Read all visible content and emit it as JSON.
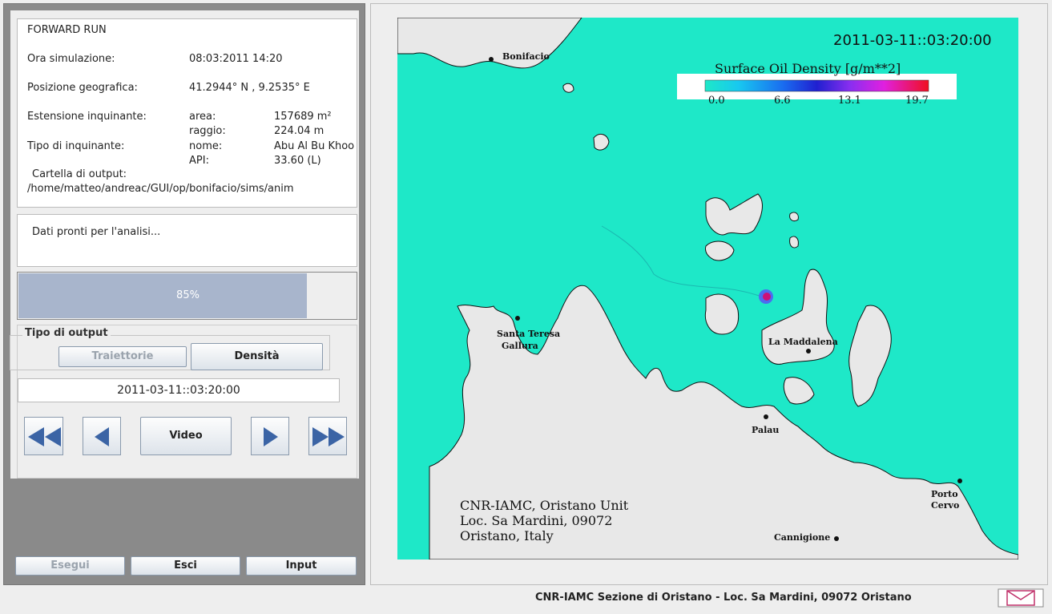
{
  "info": {
    "run_title": "FORWARD RUN",
    "sim_time_label": "Ora simulazione:",
    "sim_time_value": "08:03:2011  14:20",
    "geo_label": "Posizione geografica:",
    "geo_value": "41.2944° N , 9.2535° E",
    "extent_label": "Estensione inquinante:",
    "area_label": "area:",
    "area_value": "157689 m²",
    "radius_label": "raggio:",
    "radius_value": "224.04 m",
    "pollutant_label": "Tipo di inquinante:",
    "name_label": "nome:",
    "name_value": "Abu Al Bu Khoo",
    "api_label": "API:",
    "api_value": "33.60  (L)",
    "output_folder_label": "Cartella di output:",
    "output_folder_value": "/home/matteo/andreac/GUI/op/bonifacio/sims/anim"
  },
  "status_text": "Dati pronti per l'analisi...",
  "progress": {
    "value": 0.85,
    "label": "85%"
  },
  "output_type": {
    "legend": "Tipo di output",
    "trajectories_label": "Traiettorie",
    "density_label": "Densità"
  },
  "current_datetime": "2011-03-11::03:20:00",
  "playback": {
    "video_label": "Video",
    "rewind_icon": "fast-rewind-icon",
    "back_icon": "step-back-icon",
    "forward_icon": "step-forward-icon",
    "fastforward_icon": "fast-forward-icon"
  },
  "bottom_buttons": {
    "run_label": "Esegui",
    "exit_label": "Esci",
    "input_label": "Input"
  },
  "map": {
    "timestamp": "2011-03-11::03:20:00",
    "legend_title": "Surface Oil Density [g/m**2]",
    "legend_ticks": [
      "0.0",
      "6.6",
      "13.1",
      "19.7"
    ],
    "places": {
      "bonifacio": "Bonifacio",
      "santa_teresa_1": "Santa Teresa",
      "santa_teresa_2": "Gallura",
      "la_maddalena": "La Maddalena",
      "palau": "Palau",
      "porto_cervo_1": "Porto",
      "porto_cervo_2": "Cervo",
      "cannigione": "Cannigione"
    },
    "credits": [
      "CNR-IAMC, Oristano Unit",
      "Loc. Sa Mardini, 09072",
      "Oristano, Italy"
    ],
    "colors": {
      "sea": "#1ee8c8",
      "land": "#e8e8e8",
      "spill": "#cc1177"
    }
  },
  "footer": {
    "text": "CNR-IAMC  Sezione di Oristano - Loc. Sa Mardini, 09072  Oristano",
    "mail_icon": "mail-icon"
  }
}
